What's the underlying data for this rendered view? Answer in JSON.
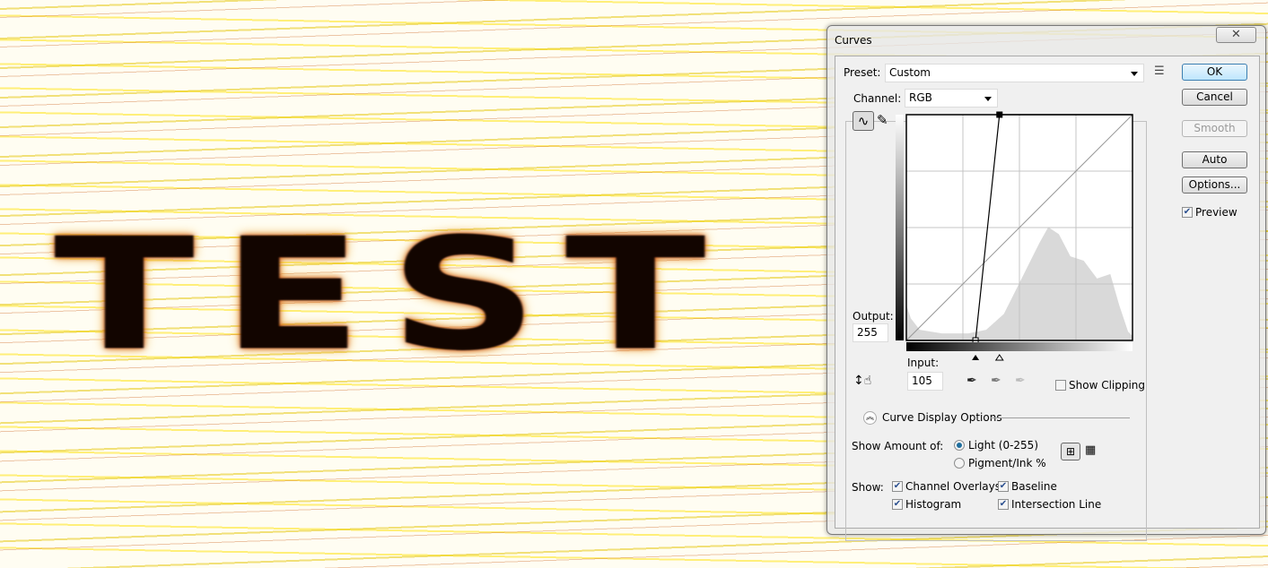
{
  "canvas": {
    "art_text": "TEST"
  },
  "dialog": {
    "title": "Curves",
    "close_label": "✕",
    "preset": {
      "label": "Preset:",
      "value": "Custom"
    },
    "channel": {
      "label": "Channel:",
      "value": "RGB"
    },
    "buttons": {
      "ok": "OK",
      "cancel": "Cancel",
      "smooth": "Smooth",
      "auto": "Auto",
      "options": "Options..."
    },
    "preview": {
      "label": "Preview",
      "checked": true
    },
    "output": {
      "label": "Output:",
      "value": "255"
    },
    "input": {
      "label": "Input:",
      "value": "105"
    },
    "show_clipping": {
      "label": "Show Clipping",
      "checked": false
    },
    "curve_display_options": "Curve Display Options",
    "show_amount": {
      "label": "Show Amount of:",
      "options": [
        "Light  (0-255)",
        "Pigment/Ink %"
      ],
      "selected": "Light  (0-255)"
    },
    "show": {
      "label": "Show:",
      "items": [
        {
          "label": "Channel Overlays",
          "checked": true
        },
        {
          "label": "Baseline",
          "checked": true
        },
        {
          "label": "Histogram",
          "checked": true
        },
        {
          "label": "Intersection Line",
          "checked": true
        }
      ]
    },
    "curve": {
      "points": [
        [
          0,
          0
        ],
        [
          78,
          0
        ],
        [
          105,
          255
        ],
        [
          255,
          255
        ]
      ],
      "selected_point": [
        105,
        255
      ],
      "black_slider": 78,
      "white_slider": 105
    },
    "colors": {
      "ok_border": "#3c7fb1",
      "histogram": "#d9d9d9"
    }
  }
}
